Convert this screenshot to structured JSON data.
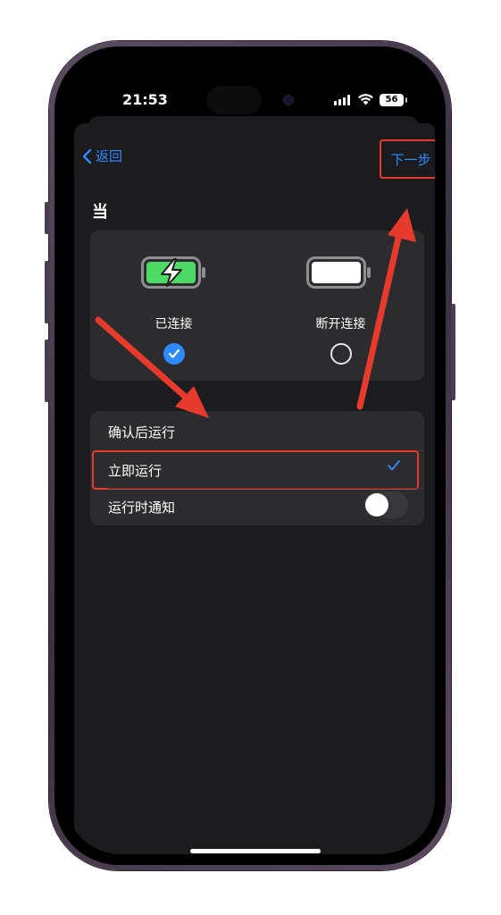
{
  "status_bar": {
    "time": "21:53",
    "battery_level": "56",
    "signal_icon": "cellular-signal-icon",
    "wifi_icon": "wifi-icon"
  },
  "nav": {
    "back_label": "返回",
    "back_icon": "chevron-left-icon",
    "next_label": "下一步"
  },
  "section_title": "当",
  "connection": {
    "options": [
      {
        "label": "已连接",
        "icon": "battery-charging-icon",
        "selected": true
      },
      {
        "label": "断开连接",
        "icon": "battery-full-icon",
        "selected": false
      }
    ]
  },
  "run_mode": {
    "options": [
      {
        "label": "确认后运行",
        "selected": false
      },
      {
        "label": "立即运行",
        "selected": true
      }
    ],
    "notify": {
      "label": "运行时通知",
      "enabled": false
    }
  },
  "colors": {
    "accent": "#2e8aff",
    "highlight": "#e53a2c",
    "charge_green": "#4cd964"
  }
}
